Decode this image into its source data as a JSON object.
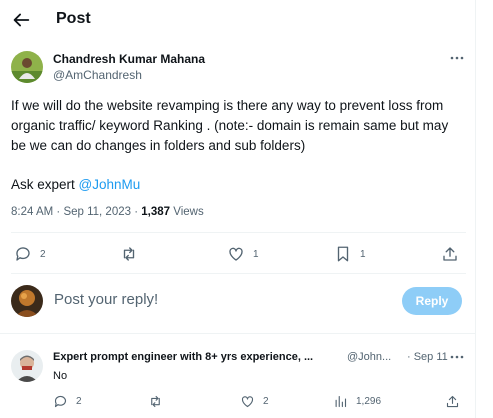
{
  "header": {
    "title": "Post"
  },
  "post": {
    "author_name": "Chandresh Kumar Mahana",
    "author_handle": "@AmChandresh",
    "text": "If we will do the website revamping is there any way to prevent loss from organic traffic/ keyword Ranking . (note:- domain is remain same but may be we can do changes in folders and sub folders)",
    "ask_prefix": "Ask expert ",
    "mention": "@JohnMu",
    "time": "8:24 AM",
    "date": "Sep 11, 2023",
    "views_count": "1,387",
    "views_label": "Views",
    "actions": {
      "replies": "2",
      "reposts": "",
      "likes": "1",
      "bookmarks": "1"
    }
  },
  "reply_box": {
    "placeholder": "Post your reply!",
    "button_label": "Reply"
  },
  "comment": {
    "author_name": "Expert prompt engineer with 8+ yrs experience, ...",
    "author_handle": "@John...",
    "time": "· Sep 11",
    "text": "No",
    "actions": {
      "replies": "2",
      "reposts": "",
      "likes": "2",
      "views": "1,296"
    }
  },
  "colors": {
    "accent": "#1d9bf0",
    "reply_button": "#8ecdf7",
    "muted": "#536471",
    "text": "#0f1419"
  },
  "icons": [
    "back-arrow-icon",
    "more-icon",
    "reply-icon",
    "repost-icon",
    "like-icon",
    "bookmark-icon",
    "share-icon",
    "views-icon"
  ]
}
